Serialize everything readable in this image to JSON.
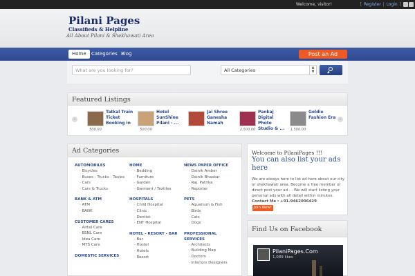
{
  "topbar": {
    "welcome": "Welcome, visitor!",
    "register": "Register",
    "login": "Login"
  },
  "header": {
    "logo_line1": "Pilani Pages",
    "logo_line2": "Classifieds & Helpline",
    "tagline": "All About Pilani & Shekhawati Area"
  },
  "nav": {
    "items": [
      "Home",
      "Categories",
      "Blog"
    ],
    "post_ad": "Post an Ad"
  },
  "search": {
    "placeholder": "What are you looking for?",
    "category": "All Categories"
  },
  "featured": {
    "title": "Featured Listings",
    "items": [
      {
        "name": "Tatkal Train Ticket Booking in",
        "price": "500.00",
        "color": "#8a6a4a"
      },
      {
        "name": "Hotel SunShine Pilani - ...",
        "price": "500.00",
        "color": "#c9a27a"
      },
      {
        "name": "Jai Shree Ganesha Namah",
        "price": "",
        "color": "#b24a3a"
      },
      {
        "name": "Pankaj Digital Photo Studio & ...",
        "price": "2,500.00",
        "color": "#a03050"
      },
      {
        "name": "Goldie Fashion Era",
        "price": "1,500.00",
        "color": "#8a8a8a"
      }
    ]
  },
  "adcategories": {
    "title": "Ad Categories",
    "columns": [
      [
        {
          "title": "AUTOMOBILES",
          "subs": [
            "Bicycles",
            "Buses - Trucks - Taxies",
            "Cars",
            "Cars & Trucks"
          ]
        },
        {
          "title": "BANK & ATM",
          "subs": [
            "ATM",
            "BANK"
          ]
        },
        {
          "title": "CUSTOMER CARES",
          "subs": [
            "Airtel Care",
            "BSNL Care",
            "Idea Care",
            "MTS Care"
          ]
        },
        {
          "title": "DOMESTIC SERVICES",
          "subs": []
        }
      ],
      [
        {
          "title": "HOME",
          "subs": [
            "Bedding",
            "Furniture",
            "Garden",
            "Garment / Textiles"
          ]
        },
        {
          "title": "HOSPITALS",
          "subs": [
            "Child Hospital",
            "Clinic",
            "Dentist",
            "ENT Hospital"
          ]
        },
        {
          "title": "HOTEL - RESORT - BAR",
          "subs": [
            "Bar",
            "Hostel",
            "Hotels",
            "Resort"
          ]
        }
      ],
      [
        {
          "title": "NEWS PAPER OFFICE",
          "subs": [
            "Dainik Amber",
            "Dainik Bhaskar",
            "Raj. Patrika",
            "Reporter"
          ]
        },
        {
          "title": "PETS",
          "subs": [
            "Aquarium & Fish",
            "Birds",
            "Cats",
            "Dogs"
          ]
        },
        {
          "title": "PROFESSIONAL SERVICES",
          "subs": [
            "Architects",
            "Building Map",
            "Doctors",
            "Interiors Designers"
          ]
        }
      ]
    ]
  },
  "welcome": {
    "title": "Welcome to PilaniPages !!!",
    "heading": "You can also list your ads here",
    "text": "We are always here to list ad here about our city or shekhawati area. Become a free member or direct post your ad . . We will start listing your personal ads with all detail within minutes.",
    "contact": "Contact Me : +91-9462006429",
    "join": "Join Now!"
  },
  "facebook": {
    "title": "Find Us on Facebook",
    "page_name": "PilaniPages.Com",
    "likes": "1,089 likes"
  },
  "colors": {
    "nav_blue": "#2f4a91",
    "accent_orange": "#ee5a24",
    "link_blue": "#2a4a8c"
  }
}
